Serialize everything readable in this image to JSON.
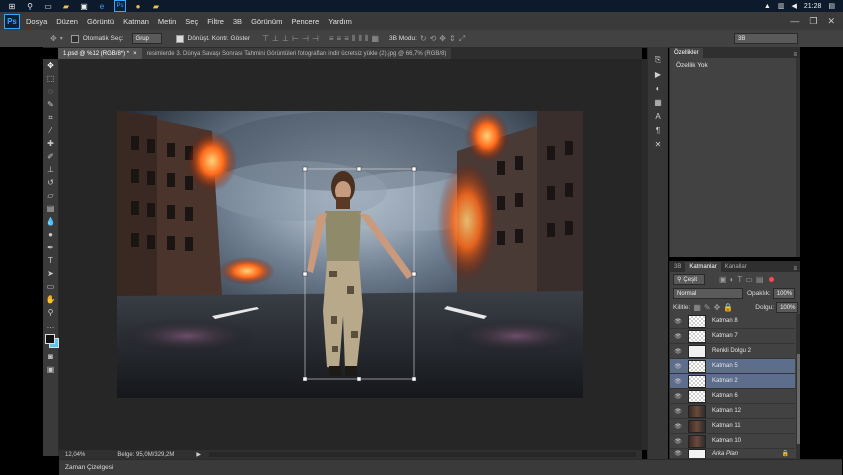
{
  "taskbar": {
    "clock": "21:28",
    "icons": [
      "windows-icon",
      "search-icon",
      "task-view-icon",
      "file-explorer-icon",
      "store-icon",
      "edge-icon",
      "photoshop-icon",
      "chrome-icon",
      "folder-icon"
    ]
  },
  "menu": {
    "logo": "Ps",
    "items": [
      "Dosya",
      "Düzen",
      "Görüntü",
      "Katman",
      "Metin",
      "Seç",
      "Filtre",
      "3B",
      "Görünüm",
      "Pencere",
      "Yardım"
    ]
  },
  "options": {
    "auto_select_label": "Otomatik Seç:",
    "group_value": "Grup",
    "transform_label": "Dönüşt. Kontr. Göster",
    "mode_3d": "3B Modu:",
    "workspace": "3B"
  },
  "tabs": [
    {
      "label": "1.psd @ %12 (RGB/8*) *",
      "active": true
    },
    {
      "label": "resimlerde 3. Dünya Savaşı Sonrası Tahmini Görüntüleri fotografları indir ücretsiz yükle (2).jpg @ 66,7% (RGB/8)",
      "active": false
    }
  ],
  "status": {
    "zoom": "12,04%",
    "doc_size": "Belge: 95,0M/329,2M"
  },
  "timeline_label": "Zaman Çizelgesi",
  "properties": {
    "tab": "Özellikler",
    "message": "Özellik Yok"
  },
  "layers_panel": {
    "tabs": [
      "3B",
      "Katmanlar",
      "Kanallar"
    ],
    "filter": "Çeşit",
    "blend_mode": "Normal",
    "opacity_label": "Opaklık:",
    "opacity_value": "100%",
    "lock_label": "Kilitle:",
    "fill_label": "Dolgu:",
    "fill_value": "100%",
    "layers": [
      {
        "name": "Katman 8",
        "thumb": "checker",
        "selected": false
      },
      {
        "name": "Katman 7",
        "thumb": "checker",
        "selected": false
      },
      {
        "name": "Renkli Dolgu 2",
        "thumb": "fill",
        "selected": false
      },
      {
        "name": "Katman 5",
        "thumb": "checker",
        "selected": true
      },
      {
        "name": "Katman 2",
        "thumb": "checker",
        "selected": true
      },
      {
        "name": "Katman 6",
        "thumb": "checker",
        "selected": false
      },
      {
        "name": "Katman 12",
        "thumb": "photo",
        "selected": false
      },
      {
        "name": "Katman 11",
        "thumb": "photo",
        "selected": false
      },
      {
        "name": "Katman 10",
        "thumb": "photo",
        "selected": false
      },
      {
        "name": "Arka Plan",
        "thumb": "white",
        "selected": false
      }
    ]
  },
  "colors": {
    "accent": "#31a8ff",
    "selection": "#5d6e8c",
    "panel": "#424242",
    "canvas_bg": "#262626"
  }
}
